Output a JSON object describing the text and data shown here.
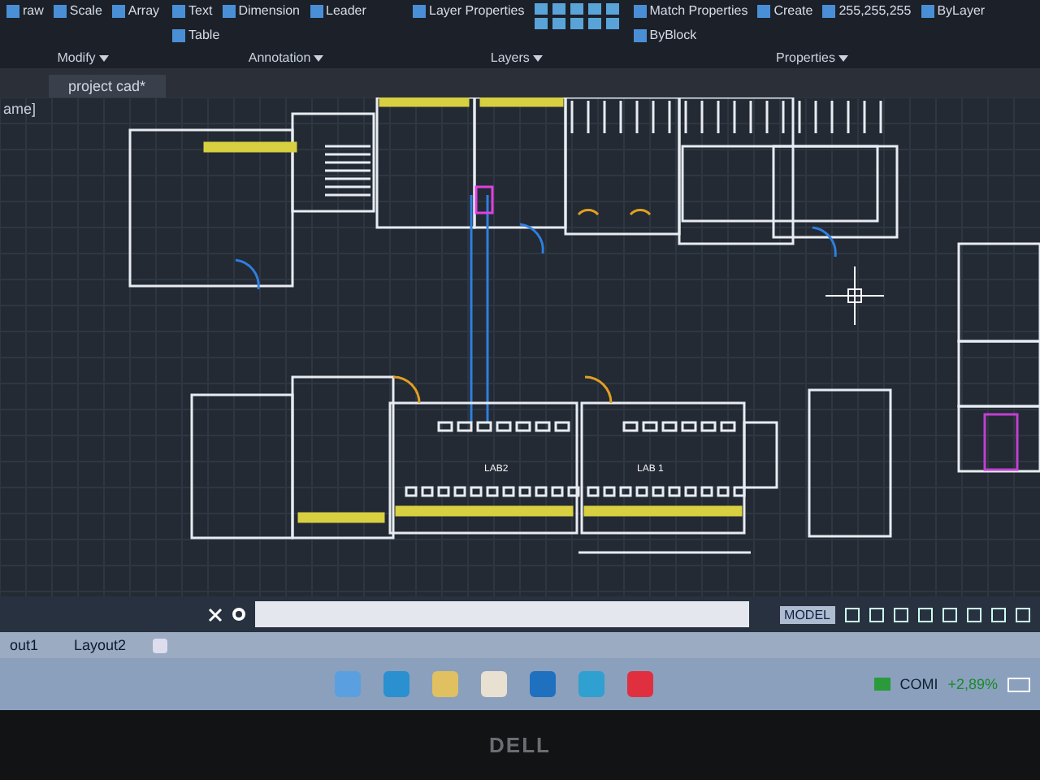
{
  "ribbon": {
    "groups": [
      {
        "title": "Modify",
        "items": [
          "raw",
          "Scale",
          "Array"
        ]
      },
      {
        "title": "Annotation",
        "items": [
          "Text",
          "Dimension",
          "Leader",
          "Table"
        ]
      },
      {
        "title": "Layers",
        "items": [
          "Layer Properties"
        ]
      },
      {
        "title": "Properties",
        "items": [
          "Match Properties",
          "Create",
          "255,255,255",
          "ByLayer",
          "ByBlock"
        ]
      }
    ]
  },
  "file_tabs": [
    {
      "label": "project cad*",
      "selected": true
    }
  ],
  "viewport_label": "ame]",
  "drawing": {
    "room_labels": [
      "LAB2",
      "LAB 1"
    ]
  },
  "status_bar": {
    "mode": "MODEL"
  },
  "layout_tabs": [
    {
      "label": "out1",
      "selected": false
    },
    {
      "label": "Layout2",
      "selected": false
    }
  ],
  "taskbar": {
    "stock_name": "COMI",
    "stock_change": "+2,89%"
  },
  "bezel": {
    "logo": "DELL"
  }
}
